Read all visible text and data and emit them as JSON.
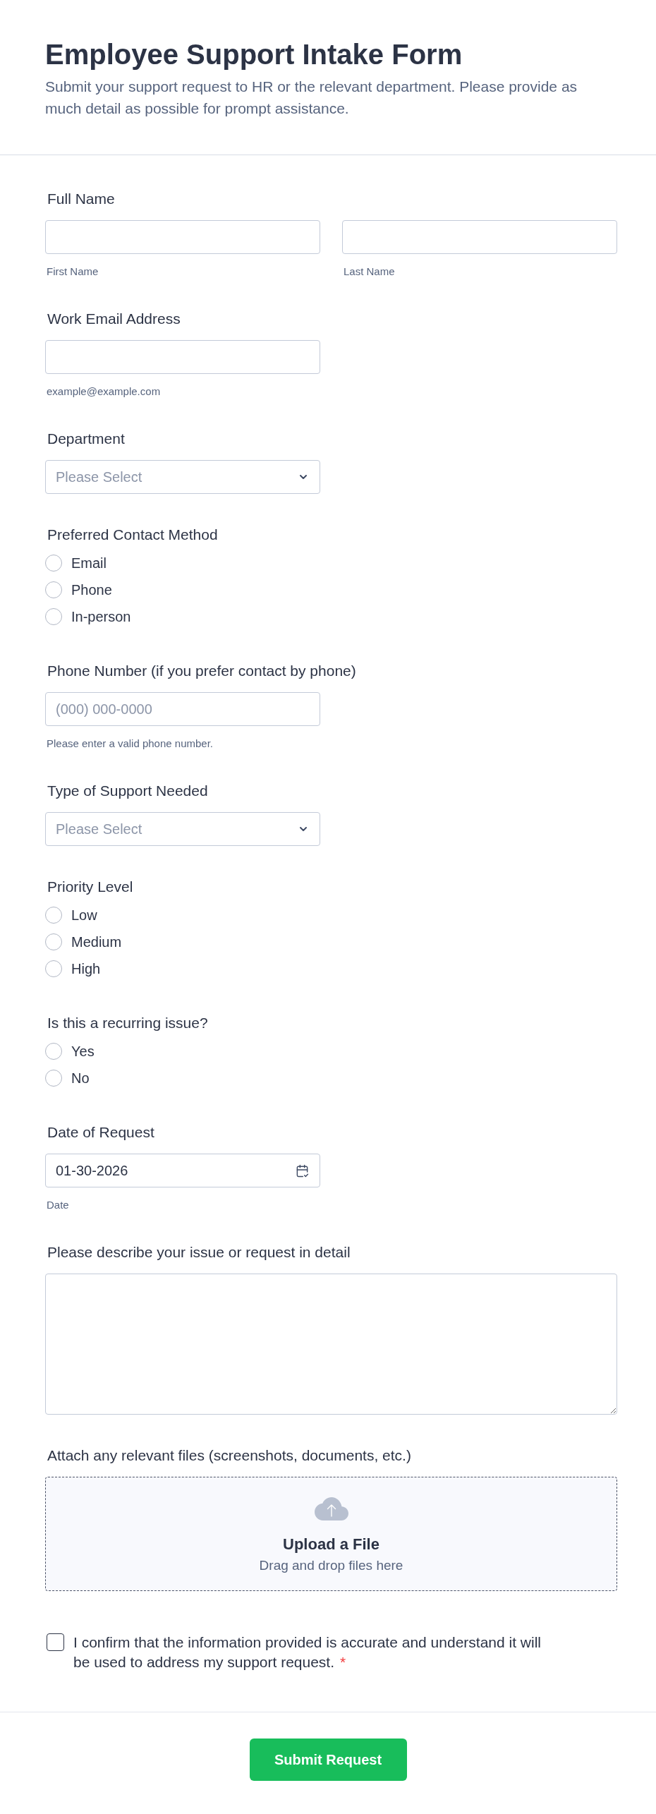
{
  "header": {
    "title": "Employee Support Intake Form",
    "description": "Submit your support request to HR or the relevant department. Please provide as much detail as possible for prompt assistance."
  },
  "fields": [
    {
      "kind": "name",
      "label": "Full Name",
      "inputs": [
        {
          "sublabel": "First Name"
        },
        {
          "sublabel": "Last Name"
        }
      ]
    },
    {
      "kind": "text",
      "label": "Work Email Address",
      "sublabel": "example@example.com"
    },
    {
      "kind": "select",
      "label": "Department",
      "placeholder": "Please Select"
    },
    {
      "kind": "radio",
      "label": "Preferred Contact Method",
      "options": [
        {
          "label": "Email",
          "selected": false
        },
        {
          "label": "Phone",
          "selected": false
        },
        {
          "label": "In-person",
          "selected": false
        }
      ]
    },
    {
      "kind": "text",
      "label": "Phone Number (if you prefer contact by phone)",
      "placeholder": "(000) 000-0000",
      "sublabel": "Please enter a valid phone number."
    },
    {
      "kind": "select",
      "label": "Type of Support Needed",
      "placeholder": "Please Select"
    },
    {
      "kind": "radio",
      "label": "Priority Level",
      "options": [
        {
          "label": "Low",
          "selected": false
        },
        {
          "label": "Medium",
          "selected": false
        },
        {
          "label": "High",
          "selected": false
        }
      ]
    },
    {
      "kind": "radio",
      "label": "Is this a recurring issue?",
      "options": [
        {
          "label": "Yes",
          "selected": false
        },
        {
          "label": "No",
          "selected": false
        }
      ]
    },
    {
      "kind": "date",
      "label": "Date of Request",
      "value": "01-30-2026",
      "sublabel": "Date"
    },
    {
      "kind": "textarea",
      "label": "Please describe your issue or request in detail"
    },
    {
      "kind": "upload",
      "label": "Attach any relevant files (screenshots, documents, etc.)",
      "title": "Upload a File",
      "hint": "Drag and drop files here"
    },
    {
      "kind": "checkbox",
      "text": "I confirm that the information provided is accurate and understand it will be used to address my support request.",
      "checked": false,
      "required_mark": "*"
    }
  ],
  "submit_button": {
    "label": "Submit Request"
  }
}
